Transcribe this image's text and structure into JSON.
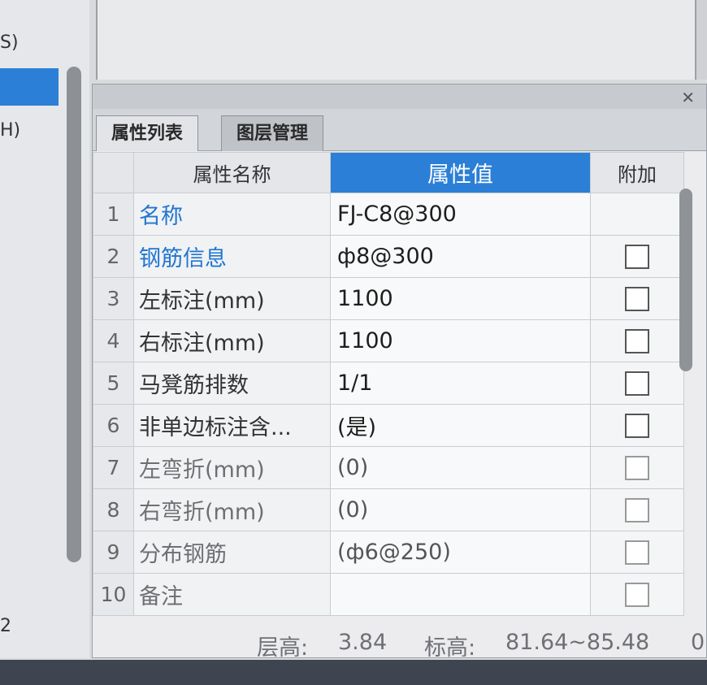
{
  "left_panel": {
    "text1": "S)",
    "text2": "H)",
    "text3": "2"
  },
  "window": {
    "close_glyph": "✕"
  },
  "tabs": [
    {
      "label": "属性列表",
      "active": true
    },
    {
      "label": "图层管理",
      "active": false
    }
  ],
  "table": {
    "headers": {
      "name": "属性名称",
      "value": "属性值",
      "extra": "附加"
    },
    "rows": [
      {
        "num": "1",
        "name": "名称",
        "value": "FJ-C8@300",
        "has_checkbox": false,
        "name_style": "blue"
      },
      {
        "num": "2",
        "name": "钢筋信息",
        "value": "ф8@300",
        "has_checkbox": true,
        "name_style": "blue"
      },
      {
        "num": "3",
        "name": "左标注(mm)",
        "value": "1100",
        "has_checkbox": true,
        "name_style": "normal"
      },
      {
        "num": "4",
        "name": "右标注(mm)",
        "value": "1100",
        "has_checkbox": true,
        "name_style": "normal"
      },
      {
        "num": "5",
        "name": "马凳筋排数",
        "value": "1/1",
        "has_checkbox": true,
        "name_style": "normal"
      },
      {
        "num": "6",
        "name": "非单边标注含...",
        "value": "(是)",
        "has_checkbox": true,
        "name_style": "normal"
      },
      {
        "num": "7",
        "name": "左弯折(mm)",
        "value": "(0)",
        "has_checkbox": true,
        "name_style": "grey"
      },
      {
        "num": "8",
        "name": "右弯折(mm)",
        "value": "(0)",
        "has_checkbox": true,
        "name_style": "grey"
      },
      {
        "num": "9",
        "name": "分布钢筋",
        "value": "(ф6@250)",
        "has_checkbox": true,
        "name_style": "grey"
      },
      {
        "num": "10",
        "name": "备注",
        "value": "",
        "has_checkbox": true,
        "name_style": "grey"
      }
    ]
  },
  "status": {
    "floor_height_label": "层高:",
    "floor_height_value": "3.84",
    "elevation_label": "标高:",
    "elevation_value": "81.64~85.48",
    "trailing": "0"
  },
  "colors": {
    "accent": "#2b7fd6",
    "name_link": "#2176d0"
  }
}
